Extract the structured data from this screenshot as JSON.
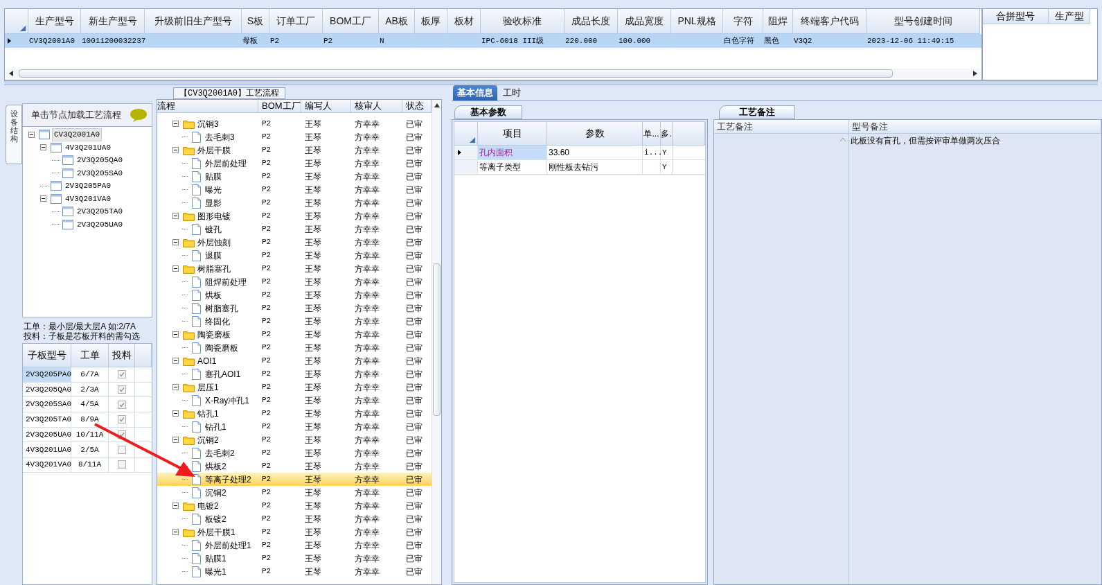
{
  "main_grid": {
    "columns": [
      "生产型号",
      "新生产型号",
      "升级前旧生产型号",
      "S板",
      "订单工厂",
      "BOM工厂",
      "AB板",
      "板厚",
      "板材",
      "验收标准",
      "成品长度",
      "成品宽度",
      "PNL规格",
      "字符",
      "阻焊",
      "终端客户代码",
      "型号创建时间"
    ],
    "rows": [
      {
        "selected": true,
        "cells": [
          "CV3Q2001A0",
          "10011200032237",
          "",
          "母板",
          "P2",
          "P2",
          "N",
          "",
          "",
          "IPC-6018 III级",
          "220.000",
          "100.000",
          "",
          "白色字符",
          "黑色",
          "V3Q2",
          "2023-12-06 11:49:15"
        ]
      }
    ]
  },
  "merge_grid": {
    "columns": [
      "合拼型号",
      "生产型"
    ]
  },
  "flow_panel": {
    "title": "【CV3Q2001A0】工艺流程"
  },
  "side_tab": "设备结构",
  "structure": {
    "hint": "单击节点加载工艺流程",
    "tree": [
      {
        "label": "CV3Q2001A0",
        "expanded": true,
        "selected": true,
        "children": [
          {
            "label": "4V3Q201UA0",
            "expanded": true,
            "selected": false,
            "children": [
              {
                "label": "2V3Q205QA0",
                "selected": false
              },
              {
                "label": "2V3Q205SA0",
                "selected": false
              }
            ]
          },
          {
            "label": "2V3Q205PA0",
            "selected": false
          },
          {
            "label": "4V3Q201VA0",
            "expanded": true,
            "selected": false,
            "children": [
              {
                "label": "2V3Q205TA0",
                "selected": false
              },
              {
                "label": "2V3Q205UA0",
                "selected": false
              }
            ]
          }
        ]
      }
    ]
  },
  "notes": [
    "工单：最小层/最大层A 如:2/7A",
    "投料：子板是芯板开料的需勾选"
  ],
  "subboards": {
    "columns": [
      "子板型号",
      "工单",
      "投料"
    ],
    "rows": [
      {
        "model": "2V3Q205PA0",
        "order": "6/7A",
        "feed": true,
        "selected": true
      },
      {
        "model": "2V3Q205QA0",
        "order": "2/3A",
        "feed": true,
        "selected": false
      },
      {
        "model": "2V3Q205SA0",
        "order": "4/5A",
        "feed": true,
        "selected": false
      },
      {
        "model": "2V3Q205TA0",
        "order": "8/9A",
        "feed": true,
        "selected": false
      },
      {
        "model": "2V3Q205UA0",
        "order": "10/11A",
        "feed": true,
        "selected": false
      },
      {
        "model": "4V3Q201UA0",
        "order": "2/5A",
        "feed": false,
        "selected": false
      },
      {
        "model": "4V3Q201VA0",
        "order": "8/11A",
        "feed": false,
        "selected": false
      }
    ]
  },
  "flow": {
    "columns": [
      "流程",
      "BOM工厂",
      "编写人",
      "核审人",
      "状态"
    ],
    "rows": [
      {
        "name": "沉铜3",
        "expanded": true,
        "bom": "P2",
        "author": "王琴",
        "reviewer": "方幸幸",
        "status": "已审",
        "selected": false,
        "children": [
          {
            "name": "去毛刺3",
            "bom": "P2",
            "author": "王琴",
            "reviewer": "方幸幸",
            "status": "已审",
            "selected": false
          }
        ]
      },
      {
        "name": "外层干膜",
        "expanded": true,
        "bom": "P2",
        "author": "王琴",
        "reviewer": "方幸幸",
        "status": "已审",
        "selected": false,
        "children": [
          {
            "name": "外层前处理",
            "bom": "P2",
            "author": "王琴",
            "reviewer": "方幸幸",
            "status": "已审",
            "selected": false
          },
          {
            "name": "贴膜",
            "bom": "P2",
            "author": "王琴",
            "reviewer": "方幸幸",
            "status": "已审",
            "selected": false
          },
          {
            "name": "曝光",
            "bom": "P2",
            "author": "王琴",
            "reviewer": "方幸幸",
            "status": "已审",
            "selected": false
          },
          {
            "name": "显影",
            "bom": "P2",
            "author": "王琴",
            "reviewer": "方幸幸",
            "status": "已审",
            "selected": false
          }
        ]
      },
      {
        "name": "图形电镀",
        "expanded": true,
        "bom": "P2",
        "author": "王琴",
        "reviewer": "方幸幸",
        "status": "已审",
        "selected": false,
        "children": [
          {
            "name": "镀孔",
            "bom": "P2",
            "author": "王琴",
            "reviewer": "方幸幸",
            "status": "已审",
            "selected": false
          }
        ]
      },
      {
        "name": "外层蚀刻",
        "expanded": true,
        "bom": "P2",
        "author": "王琴",
        "reviewer": "方幸幸",
        "status": "已审",
        "selected": false,
        "children": [
          {
            "name": "退膜",
            "bom": "P2",
            "author": "王琴",
            "reviewer": "方幸幸",
            "status": "已审",
            "selected": false
          }
        ]
      },
      {
        "name": "树脂塞孔",
        "expanded": true,
        "bom": "P2",
        "author": "王琴",
        "reviewer": "方幸幸",
        "status": "已审",
        "selected": false,
        "children": [
          {
            "name": "阻焊前处理",
            "bom": "P2",
            "author": "王琴",
            "reviewer": "方幸幸",
            "status": "已审",
            "selected": false
          },
          {
            "name": "烘板",
            "bom": "P2",
            "author": "王琴",
            "reviewer": "方幸幸",
            "status": "已审",
            "selected": false
          },
          {
            "name": "树脂塞孔",
            "bom": "P2",
            "author": "王琴",
            "reviewer": "方幸幸",
            "status": "已审",
            "selected": false
          },
          {
            "name": "终固化",
            "bom": "P2",
            "author": "王琴",
            "reviewer": "方幸幸",
            "status": "已审",
            "selected": false
          }
        ]
      },
      {
        "name": "陶瓷磨板",
        "expanded": true,
        "bom": "P2",
        "author": "王琴",
        "reviewer": "方幸幸",
        "status": "已审",
        "selected": false,
        "children": [
          {
            "name": "陶瓷磨板",
            "bom": "P2",
            "author": "王琴",
            "reviewer": "方幸幸",
            "status": "已审",
            "selected": false
          }
        ]
      },
      {
        "name": "AOI1",
        "expanded": true,
        "bom": "P2",
        "author": "王琴",
        "reviewer": "方幸幸",
        "status": "已审",
        "selected": false,
        "children": [
          {
            "name": "塞孔AOI1",
            "bom": "P2",
            "author": "王琴",
            "reviewer": "方幸幸",
            "status": "已审",
            "selected": false
          }
        ]
      },
      {
        "name": "层压1",
        "expanded": true,
        "bom": "P2",
        "author": "王琴",
        "reviewer": "方幸幸",
        "status": "已审",
        "selected": false,
        "children": [
          {
            "name": "X-Ray冲孔1",
            "bom": "P2",
            "author": "王琴",
            "reviewer": "方幸幸",
            "status": "已审",
            "selected": false
          }
        ]
      },
      {
        "name": "钻孔1",
        "expanded": true,
        "bom": "P2",
        "author": "王琴",
        "reviewer": "方幸幸",
        "status": "已审",
        "selected": false,
        "children": [
          {
            "name": "钻孔1",
            "bom": "P2",
            "author": "王琴",
            "reviewer": "方幸幸",
            "status": "已审",
            "selected": false
          }
        ]
      },
      {
        "name": "沉铜2",
        "expanded": true,
        "bom": "P2",
        "author": "王琴",
        "reviewer": "方幸幸",
        "status": "已审",
        "selected": false,
        "children": [
          {
            "name": "去毛刺2",
            "bom": "P2",
            "author": "王琴",
            "reviewer": "方幸幸",
            "status": "已审",
            "selected": false
          },
          {
            "name": "烘板2",
            "bom": "P2",
            "author": "王琴",
            "reviewer": "方幸幸",
            "status": "已审",
            "selected": false
          },
          {
            "name": "等离子处理2",
            "bom": "P2",
            "author": "王琴",
            "reviewer": "方幸幸",
            "status": "已审",
            "selected": true
          },
          {
            "name": "沉铜2",
            "bom": "P2",
            "author": "王琴",
            "reviewer": "方幸幸",
            "status": "已审",
            "selected": false
          }
        ]
      },
      {
        "name": "电镀2",
        "expanded": true,
        "bom": "P2",
        "author": "王琴",
        "reviewer": "方幸幸",
        "status": "已审",
        "selected": false,
        "children": [
          {
            "name": "板镀2",
            "bom": "P2",
            "author": "王琴",
            "reviewer": "方幸幸",
            "status": "已审",
            "selected": false
          }
        ]
      },
      {
        "name": "外层干膜1",
        "expanded": true,
        "bom": "P2",
        "author": "王琴",
        "reviewer": "方幸幸",
        "status": "已审",
        "selected": false,
        "children": [
          {
            "name": "外层前处理1",
            "bom": "P2",
            "author": "王琴",
            "reviewer": "方幸幸",
            "status": "已审",
            "selected": false
          },
          {
            "name": "贴膜1",
            "bom": "P2",
            "author": "王琴",
            "reviewer": "方幸幸",
            "status": "已审",
            "selected": false
          },
          {
            "name": "曝光1",
            "bom": "P2",
            "author": "王琴",
            "reviewer": "方幸幸",
            "status": "已审",
            "selected": false
          }
        ]
      }
    ]
  },
  "tabs": [
    {
      "label": "基本信息",
      "selected": true
    },
    {
      "label": "工时",
      "selected": false
    }
  ],
  "params": {
    "tab": "基本参数",
    "columns": [
      "项目",
      "参数",
      "单...",
      "多."
    ],
    "rows": [
      {
        "selected": true,
        "cells": [
          "孔内面积",
          "33.60",
          "i...",
          "Y"
        ]
      },
      {
        "selected": false,
        "cells": [
          "等离子类型",
          "刚性板去钻污",
          "",
          "Y"
        ]
      }
    ]
  },
  "remarks": {
    "tab": "工艺备注",
    "columns": [
      "工艺备注",
      "型号备注"
    ],
    "model_remark": "此板没有盲孔，但需按评审单做两次压合"
  }
}
